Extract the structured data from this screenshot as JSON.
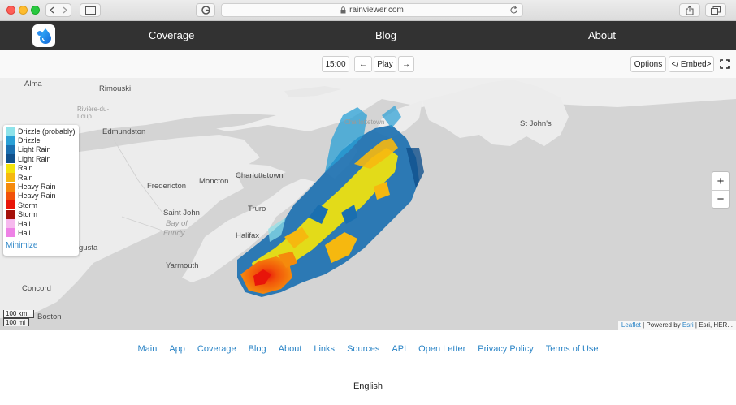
{
  "browser": {
    "url": "rainviewer.com"
  },
  "nav": {
    "links": [
      "Coverage",
      "Blog",
      "About"
    ]
  },
  "toolbar": {
    "time": "15:00",
    "prev": "←",
    "play": "Play",
    "next": "→",
    "options": "Options",
    "embed": "</ Embed>"
  },
  "map": {
    "places": [
      "Alma",
      "Rimouski",
      "Edmundston",
      "Moncton",
      "Charlottetown",
      "Fredericton",
      "Saint John",
      "Truro",
      "Halifax",
      "Yarmouth",
      "Augusta",
      "Concord",
      "Boston",
      "St John's",
      "Rivière-du-Loup",
      "Charlottetown (faint)"
    ],
    "place_labels": {
      "alma": "Alma",
      "rimouski": "Rimouski",
      "riviere": "Rivière-du-Loup",
      "edmundston": "Edmundston",
      "moncton": "Moncton",
      "charlottetown": "Charlottetown",
      "fredericton": "Fredericton",
      "saintjohn": "Saint John",
      "bay": "Bay of",
      "fundy": "Fundy",
      "truro": "Truro",
      "halifax": "Halifax",
      "yarmouth": "Yarmouth",
      "augusta": "gusta",
      "concord": "Concord",
      "boston": "Boston",
      "stjohns": "St John's",
      "chametown": "Charlottetown"
    },
    "zoom_in": "+",
    "zoom_out": "−",
    "scale_km": "100 km",
    "scale_mi": "100 mi",
    "attribution": {
      "leaflet": "Leaflet",
      "sep1": " | Powered by ",
      "esri": "Esri",
      "rest": " | Esri, HER..."
    }
  },
  "legend": {
    "items": [
      {
        "label": "Drizzle (probably)",
        "color": "#8ee3ea"
      },
      {
        "label": "Drizzle",
        "color": "#2aa0d6"
      },
      {
        "label": "Light Rain",
        "color": "#1a6fb0"
      },
      {
        "label": "Light Rain",
        "color": "#10508c"
      },
      {
        "label": "Rain",
        "color": "#f3e40c"
      },
      {
        "label": "Rain",
        "color": "#f6b80f"
      },
      {
        "label": "Heavy Rain",
        "color": "#f58a0c"
      },
      {
        "label": "Heavy Rain",
        "color": "#f2520a"
      },
      {
        "label": "Storm",
        "color": "#e8150a"
      },
      {
        "label": "Storm",
        "color": "#a5100a"
      },
      {
        "label": "Hail",
        "color": "#f6b9ee"
      },
      {
        "label": "Hail",
        "color": "#ee82e6"
      }
    ],
    "minimize": "Minimize"
  },
  "footer": {
    "links": [
      "Main",
      "App",
      "Coverage",
      "Blog",
      "About",
      "Links",
      "Sources",
      "API",
      "Open Letter",
      "Privacy Policy",
      "Terms of Use"
    ],
    "language": "English"
  }
}
